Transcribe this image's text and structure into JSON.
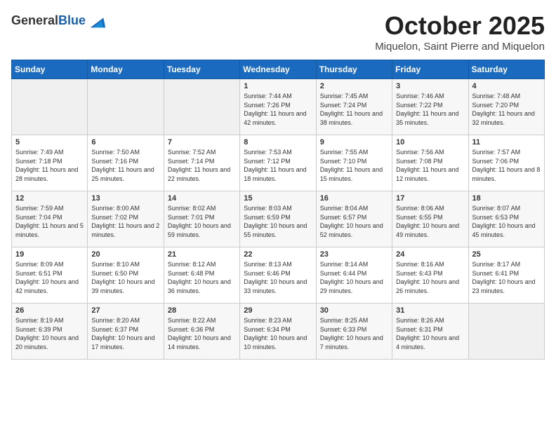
{
  "header": {
    "logo_general": "General",
    "logo_blue": "Blue",
    "month_title": "October 2025",
    "location": "Miquelon, Saint Pierre and Miquelon"
  },
  "weekdays": [
    "Sunday",
    "Monday",
    "Tuesday",
    "Wednesday",
    "Thursday",
    "Friday",
    "Saturday"
  ],
  "weeks": [
    [
      {
        "day": "",
        "info": ""
      },
      {
        "day": "",
        "info": ""
      },
      {
        "day": "",
        "info": ""
      },
      {
        "day": "1",
        "info": "Sunrise: 7:44 AM\nSunset: 7:26 PM\nDaylight: 11 hours and 42 minutes."
      },
      {
        "day": "2",
        "info": "Sunrise: 7:45 AM\nSunset: 7:24 PM\nDaylight: 11 hours and 38 minutes."
      },
      {
        "day": "3",
        "info": "Sunrise: 7:46 AM\nSunset: 7:22 PM\nDaylight: 11 hours and 35 minutes."
      },
      {
        "day": "4",
        "info": "Sunrise: 7:48 AM\nSunset: 7:20 PM\nDaylight: 11 hours and 32 minutes."
      }
    ],
    [
      {
        "day": "5",
        "info": "Sunrise: 7:49 AM\nSunset: 7:18 PM\nDaylight: 11 hours and 28 minutes."
      },
      {
        "day": "6",
        "info": "Sunrise: 7:50 AM\nSunset: 7:16 PM\nDaylight: 11 hours and 25 minutes."
      },
      {
        "day": "7",
        "info": "Sunrise: 7:52 AM\nSunset: 7:14 PM\nDaylight: 11 hours and 22 minutes."
      },
      {
        "day": "8",
        "info": "Sunrise: 7:53 AM\nSunset: 7:12 PM\nDaylight: 11 hours and 18 minutes."
      },
      {
        "day": "9",
        "info": "Sunrise: 7:55 AM\nSunset: 7:10 PM\nDaylight: 11 hours and 15 minutes."
      },
      {
        "day": "10",
        "info": "Sunrise: 7:56 AM\nSunset: 7:08 PM\nDaylight: 11 hours and 12 minutes."
      },
      {
        "day": "11",
        "info": "Sunrise: 7:57 AM\nSunset: 7:06 PM\nDaylight: 11 hours and 8 minutes."
      }
    ],
    [
      {
        "day": "12",
        "info": "Sunrise: 7:59 AM\nSunset: 7:04 PM\nDaylight: 11 hours and 5 minutes."
      },
      {
        "day": "13",
        "info": "Sunrise: 8:00 AM\nSunset: 7:02 PM\nDaylight: 11 hours and 2 minutes."
      },
      {
        "day": "14",
        "info": "Sunrise: 8:02 AM\nSunset: 7:01 PM\nDaylight: 10 hours and 59 minutes."
      },
      {
        "day": "15",
        "info": "Sunrise: 8:03 AM\nSunset: 6:59 PM\nDaylight: 10 hours and 55 minutes."
      },
      {
        "day": "16",
        "info": "Sunrise: 8:04 AM\nSunset: 6:57 PM\nDaylight: 10 hours and 52 minutes."
      },
      {
        "day": "17",
        "info": "Sunrise: 8:06 AM\nSunset: 6:55 PM\nDaylight: 10 hours and 49 minutes."
      },
      {
        "day": "18",
        "info": "Sunrise: 8:07 AM\nSunset: 6:53 PM\nDaylight: 10 hours and 45 minutes."
      }
    ],
    [
      {
        "day": "19",
        "info": "Sunrise: 8:09 AM\nSunset: 6:51 PM\nDaylight: 10 hours and 42 minutes."
      },
      {
        "day": "20",
        "info": "Sunrise: 8:10 AM\nSunset: 6:50 PM\nDaylight: 10 hours and 39 minutes."
      },
      {
        "day": "21",
        "info": "Sunrise: 8:12 AM\nSunset: 6:48 PM\nDaylight: 10 hours and 36 minutes."
      },
      {
        "day": "22",
        "info": "Sunrise: 8:13 AM\nSunset: 6:46 PM\nDaylight: 10 hours and 33 minutes."
      },
      {
        "day": "23",
        "info": "Sunrise: 8:14 AM\nSunset: 6:44 PM\nDaylight: 10 hours and 29 minutes."
      },
      {
        "day": "24",
        "info": "Sunrise: 8:16 AM\nSunset: 6:43 PM\nDaylight: 10 hours and 26 minutes."
      },
      {
        "day": "25",
        "info": "Sunrise: 8:17 AM\nSunset: 6:41 PM\nDaylight: 10 hours and 23 minutes."
      }
    ],
    [
      {
        "day": "26",
        "info": "Sunrise: 8:19 AM\nSunset: 6:39 PM\nDaylight: 10 hours and 20 minutes."
      },
      {
        "day": "27",
        "info": "Sunrise: 8:20 AM\nSunset: 6:37 PM\nDaylight: 10 hours and 17 minutes."
      },
      {
        "day": "28",
        "info": "Sunrise: 8:22 AM\nSunset: 6:36 PM\nDaylight: 10 hours and 14 minutes."
      },
      {
        "day": "29",
        "info": "Sunrise: 8:23 AM\nSunset: 6:34 PM\nDaylight: 10 hours and 10 minutes."
      },
      {
        "day": "30",
        "info": "Sunrise: 8:25 AM\nSunset: 6:33 PM\nDaylight: 10 hours and 7 minutes."
      },
      {
        "day": "31",
        "info": "Sunrise: 8:26 AM\nSunset: 6:31 PM\nDaylight: 10 hours and 4 minutes."
      },
      {
        "day": "",
        "info": ""
      }
    ]
  ]
}
